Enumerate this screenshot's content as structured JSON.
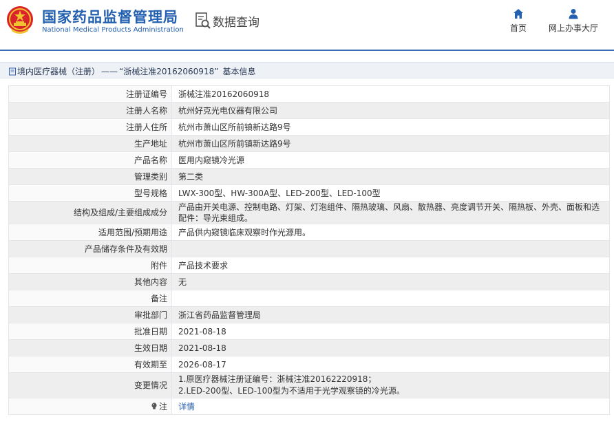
{
  "header": {
    "agency_cn": "国家药品监督管理局",
    "agency_en": "National Medical Products Administration",
    "query_label": "数据查询",
    "nav": [
      {
        "label": "首页",
        "icon": "home-icon"
      },
      {
        "label": "网上办事大厅",
        "icon": "user-icon"
      }
    ]
  },
  "breadcrumb": {
    "category": "境内医疗器械（注册）",
    "separator": "——",
    "record": "“浙械注准20162060918”",
    "suffix": "基本信息"
  },
  "detail": {
    "rows": [
      {
        "label": "注册证编号",
        "value": "浙械注准20162060918"
      },
      {
        "label": "注册人名称",
        "value": "杭州好克光电仪器有限公司"
      },
      {
        "label": "注册人住所",
        "value": "杭州市萧山区所前镇新达路9号"
      },
      {
        "label": "生产地址",
        "value": "杭州市萧山区所前镇新达路9号"
      },
      {
        "label": "产品名称",
        "value": "医用内窥镜冷光源"
      },
      {
        "label": "管理类别",
        "value": "第二类"
      },
      {
        "label": "型号规格",
        "value": "LWX-300型、HW-300A型、LED-200型、LED-100型"
      },
      {
        "label": "结构及组成/主要组成成分",
        "value": "产品由开关电源、控制电路、灯架、灯泡组件、隔热玻璃、风扇、散热器、亮度调节开关、隔热板、外壳、面板和选配件：导光束组成。"
      },
      {
        "label": "适用范围/预期用途",
        "value": "产品供内窥镜临床观察时作光源用。"
      },
      {
        "label": "产品储存条件及有效期",
        "value": ""
      },
      {
        "label": "附件",
        "value": "产品技术要求"
      },
      {
        "label": "其他内容",
        "value": "无"
      },
      {
        "label": "备注",
        "value": ""
      },
      {
        "label": "审批部门",
        "value": "浙江省药品监督管理局"
      },
      {
        "label": "批准日期",
        "value": "2021-08-18"
      },
      {
        "label": "生效日期",
        "value": "2021-08-18"
      },
      {
        "label": "有效期至",
        "value": "2026-08-17"
      }
    ],
    "change_label": "变更情况",
    "change_lines": [
      "1.原医疗器械注册证编号：浙械注准20162220918；",
      "2.LED-200型、LED-100型为不适用于光学观察镜的冷光源。"
    ],
    "note_label": "注",
    "note_link": "详情"
  },
  "colors": {
    "brand_blue": "#2360b0",
    "rule_blue": "#3e6fb5",
    "link_blue": "#2d64b3",
    "row_shade": "#eeeeee"
  }
}
